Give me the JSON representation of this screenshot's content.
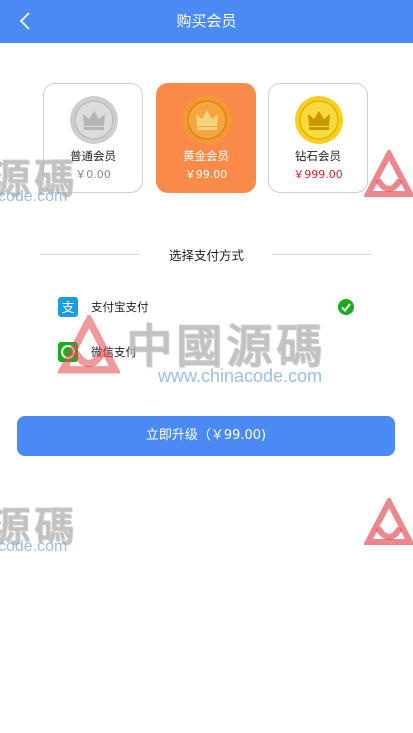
{
  "header": {
    "title": "购买会员"
  },
  "plans": [
    {
      "name": "普通会员",
      "price": "￥0.00",
      "selected": false,
      "coin_color": "#c9c9c9"
    },
    {
      "name": "黄金会员",
      "price": "￥99.00",
      "selected": true,
      "coin_color": "#f39a32"
    },
    {
      "name": "钻石会员",
      "price": "￥999.00",
      "selected": false,
      "coin_color": "#f7cf1e"
    }
  ],
  "payment": {
    "section_title": "选择支付方式",
    "methods": [
      {
        "label": "支付宝支付",
        "icon": "alipay-icon",
        "checked": true
      },
      {
        "label": "微信支付",
        "icon": "wechat-pay-icon",
        "checked": false
      }
    ]
  },
  "submit": {
    "label": "立即升级（￥99.00)"
  },
  "watermark": {
    "cn_text": "中國源碼",
    "cn_text_partial": "源碼",
    "url_text": "www.chinacode.com",
    "url_text_partial": "code.com"
  },
  "colors": {
    "primary": "#4a8af4",
    "selected_card": "#fa8a4a",
    "price_red": "#e02020",
    "check_green": "#1aad19"
  }
}
